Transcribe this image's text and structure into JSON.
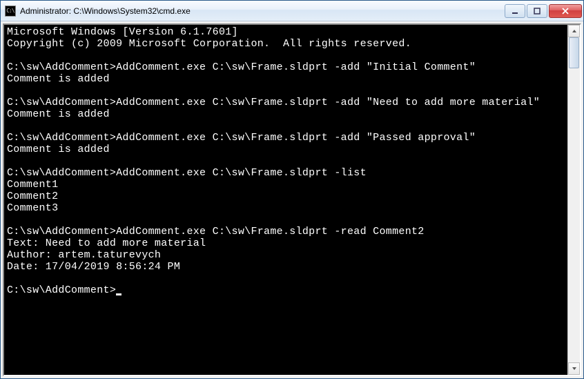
{
  "titlebar": {
    "icon_label": "C:\\",
    "title": "Administrator: C:\\Windows\\System32\\cmd.exe"
  },
  "terminal": {
    "header_line1": "Microsoft Windows [Version 6.1.7601]",
    "header_line2": "Copyright (c) 2009 Microsoft Corporation.  All rights reserved.",
    "prompt": "C:\\sw\\AddComment>",
    "blocks": [
      {
        "cmd": "AddComment.exe C:\\sw\\Frame.sldprt -add \"Initial Comment\"",
        "out": [
          "Comment is added"
        ]
      },
      {
        "cmd": "AddComment.exe C:\\sw\\Frame.sldprt -add \"Need to add more material\"",
        "out": [
          "Comment is added"
        ]
      },
      {
        "cmd": "AddComment.exe C:\\sw\\Frame.sldprt -add \"Passed approval\"",
        "out": [
          "Comment is added"
        ]
      },
      {
        "cmd": "AddComment.exe C:\\sw\\Frame.sldprt -list",
        "out": [
          "Comment1",
          "Comment2",
          "Comment3"
        ]
      },
      {
        "cmd": "AddComment.exe C:\\sw\\Frame.sldprt -read Comment2",
        "out": [
          "Text: Need to add more material",
          "Author: artem.taturevych",
          "Date: 17/04/2019 8:56:24 PM"
        ]
      }
    ]
  }
}
